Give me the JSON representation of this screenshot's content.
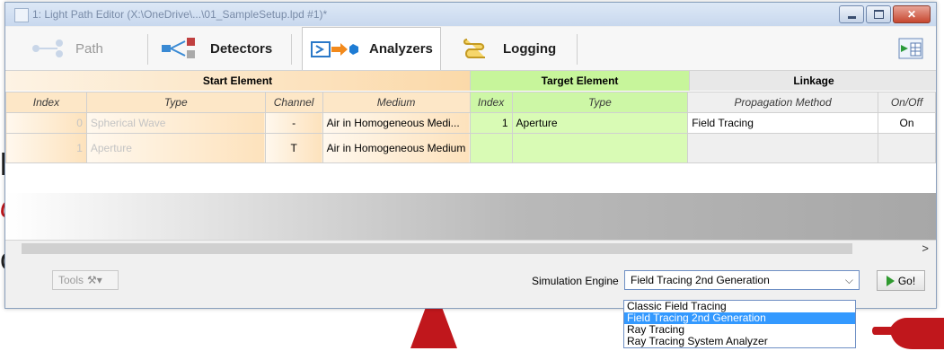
{
  "background": {
    "text_1": "pe",
    "text_2": "cing",
    "text_3": "of",
    "accent_color": "#c0171c"
  },
  "window": {
    "title": "1: Light Path Editor (X:\\OneDrive\\...\\01_SampleSetup.lpd #1)*"
  },
  "toolbar": {
    "items": [
      {
        "label": "Path",
        "icon": "path-icon"
      },
      {
        "label": "Detectors",
        "icon": "detectors-icon"
      },
      {
        "label": "Analyzers",
        "icon": "analyzers-icon"
      },
      {
        "label": "Logging",
        "icon": "logging-icon"
      }
    ]
  },
  "table": {
    "groups": {
      "start": "Start Element",
      "target": "Target Element",
      "linkage": "Linkage"
    },
    "columns": [
      "Index",
      "Type",
      "Channel",
      "Medium",
      "Index",
      "Type",
      "Propagation Method",
      "On/Off"
    ],
    "rows": [
      [
        "0",
        "Spherical Wave",
        "-",
        "Air in Homogeneous Medi...",
        "1",
        "Aperture",
        "Field Tracing",
        "On"
      ],
      [
        "1",
        "Aperture",
        "T",
        "Air in Homogeneous Medium",
        "",
        "",
        "",
        ""
      ]
    ]
  },
  "bottom": {
    "tools_label": "Tools",
    "sim_engine_label": "Simulation Engine",
    "sim_engine_value": "Field Tracing 2nd Generation",
    "go_label": "Go!",
    "options": [
      "Classic Field Tracing",
      "Field Tracing 2nd Generation",
      "Ray Tracing",
      "Ray Tracing System Analyzer"
    ],
    "selected_index": 1
  }
}
